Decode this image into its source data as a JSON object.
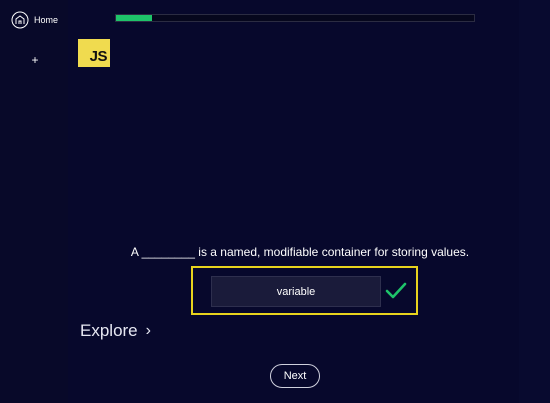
{
  "sidebar": {
    "home_label": "Home",
    "home_icon": "home-icon",
    "add_label": "+"
  },
  "progress": {
    "value_fraction": 0.1,
    "fill_color": "#1ec46a"
  },
  "course_logo": {
    "text": "JS",
    "color": "#f0db4f"
  },
  "question": {
    "text": "A ________ is a named, modifiable container for storing values."
  },
  "answer": {
    "value": "variable",
    "status": "correct",
    "status_icon": "check-icon",
    "highlight_color": "#e8d31d",
    "check_color": "#1ec46a"
  },
  "explore": {
    "label": "Explore",
    "chevron": "›"
  },
  "next_button": {
    "label": "Next"
  }
}
